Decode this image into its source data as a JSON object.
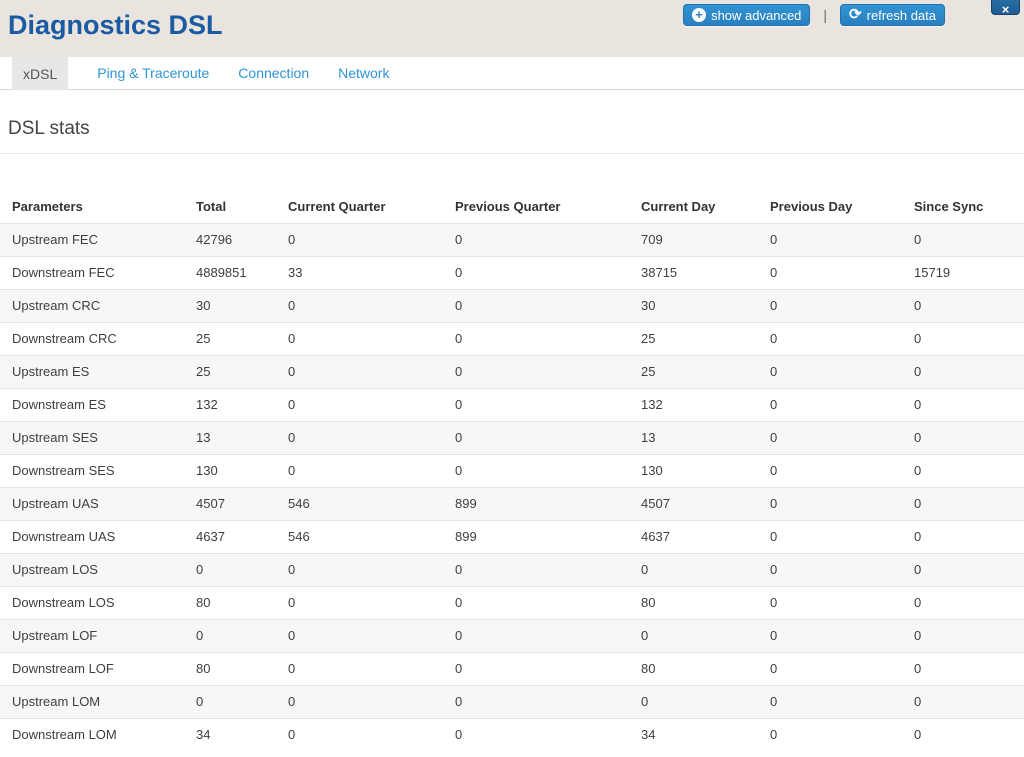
{
  "header": {
    "title": "Diagnostics DSL",
    "actions": {
      "show_advanced_label": "show advanced",
      "divider": "|",
      "refresh_label": "refresh data"
    },
    "icons": {
      "plus_circle": "+",
      "refresh": "⟳",
      "close": "×"
    },
    "colors": {
      "header_background": "#e9e5de",
      "title_blue": "#1b5ba3",
      "button_blue": "#2a80c0",
      "close_button_blue": "#1f5c93",
      "tab_link_blue": "#2e94d4"
    }
  },
  "tabs": [
    {
      "label": "xDSL",
      "active": true
    },
    {
      "label": "Ping & Traceroute",
      "active": false
    },
    {
      "label": "Connection",
      "active": false
    },
    {
      "label": "Network",
      "active": false
    }
  ],
  "section": {
    "title": "DSL stats"
  },
  "table": {
    "columns": [
      "Parameters",
      "Total",
      "Current Quarter",
      "Previous Quarter",
      "Current Day",
      "Previous Day",
      "Since Sync"
    ],
    "rows": [
      [
        "Upstream FEC",
        "42796",
        "0",
        "0",
        "709",
        "0",
        "0"
      ],
      [
        "Downstream FEC",
        "4889851",
        "33",
        "0",
        "38715",
        "0",
        "15719"
      ],
      [
        "Upstream CRC",
        "30",
        "0",
        "0",
        "30",
        "0",
        "0"
      ],
      [
        "Downstream CRC",
        "25",
        "0",
        "0",
        "25",
        "0",
        "0"
      ],
      [
        "Upstream ES",
        "25",
        "0",
        "0",
        "25",
        "0",
        "0"
      ],
      [
        "Downstream ES",
        "132",
        "0",
        "0",
        "132",
        "0",
        "0"
      ],
      [
        "Upstream SES",
        "13",
        "0",
        "0",
        "13",
        "0",
        "0"
      ],
      [
        "Downstream SES",
        "130",
        "0",
        "0",
        "130",
        "0",
        "0"
      ],
      [
        "Upstream UAS",
        "4507",
        "546",
        "899",
        "4507",
        "0",
        "0"
      ],
      [
        "Downstream UAS",
        "4637",
        "546",
        "899",
        "4637",
        "0",
        "0"
      ],
      [
        "Upstream LOS",
        "0",
        "0",
        "0",
        "0",
        "0",
        "0"
      ],
      [
        "Downstream LOS",
        "80",
        "0",
        "0",
        "80",
        "0",
        "0"
      ],
      [
        "Upstream LOF",
        "0",
        "0",
        "0",
        "0",
        "0",
        "0"
      ],
      [
        "Downstream LOF",
        "80",
        "0",
        "0",
        "80",
        "0",
        "0"
      ],
      [
        "Upstream LOM",
        "0",
        "0",
        "0",
        "0",
        "0",
        "0"
      ],
      [
        "Downstream LOM",
        "34",
        "0",
        "0",
        "34",
        "0",
        "0"
      ]
    ]
  }
}
